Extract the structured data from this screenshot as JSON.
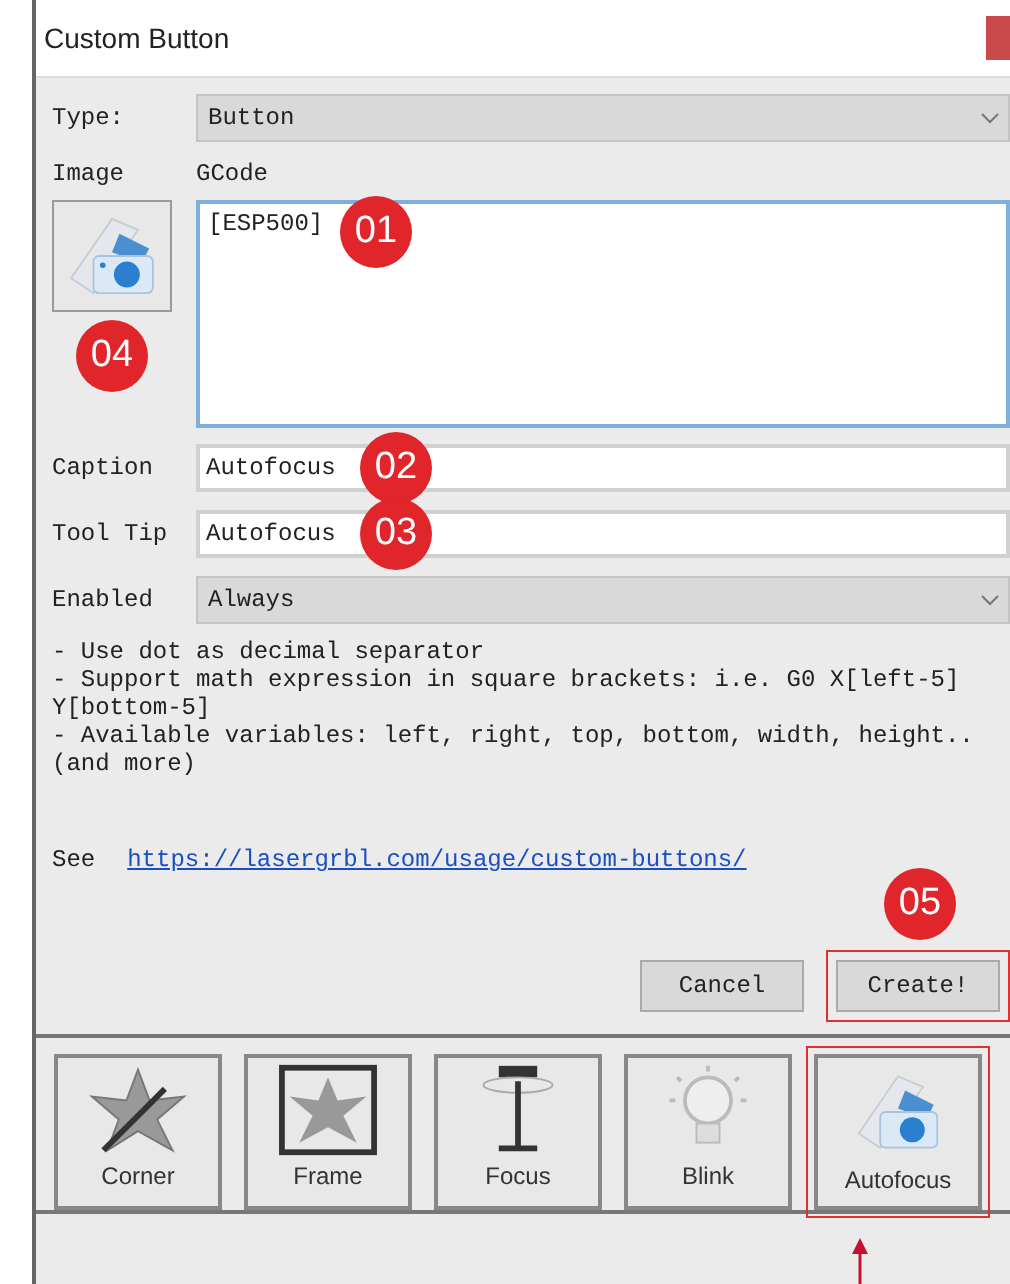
{
  "window": {
    "title": "Custom Button"
  },
  "type": {
    "label": "Type:",
    "value": "Button"
  },
  "image": {
    "label": "Image",
    "badge": "04"
  },
  "gcode": {
    "label": "GCode",
    "value": "[ESP500]",
    "badge": "01"
  },
  "caption": {
    "label": "Caption",
    "value": "Autofocus",
    "badge": "02"
  },
  "tool_tip": {
    "label": "Tool Tip",
    "value": "Autofocus",
    "badge": "03"
  },
  "enabled": {
    "label": "Enabled",
    "value": "Always"
  },
  "notes": [
    "- Use dot as decimal separator",
    "- Support math expression in square brackets: i.e. G0 X[left-5] Y[bottom-5]",
    "- Available variables: left, right, top, bottom, width, height.. (and more)"
  ],
  "see": {
    "label": "See",
    "link": "https://lasergrbl.com/usage/custom-buttons/"
  },
  "buttons": [
    {
      "label": "Cancel",
      "highlighted": false
    },
    {
      "label": "Create!",
      "highlighted": true,
      "badge": "05"
    }
  ],
  "toolbar": [
    {
      "label": "Corner",
      "kind": "corner",
      "highlighted": false
    },
    {
      "label": "Frame",
      "kind": "frame",
      "highlighted": false
    },
    {
      "label": "Focus",
      "kind": "focus",
      "highlighted": false
    },
    {
      "label": "Blink",
      "kind": "blink",
      "highlighted": false
    },
    {
      "label": "Autofocus",
      "kind": "autofocus",
      "highlighted": true
    }
  ]
}
